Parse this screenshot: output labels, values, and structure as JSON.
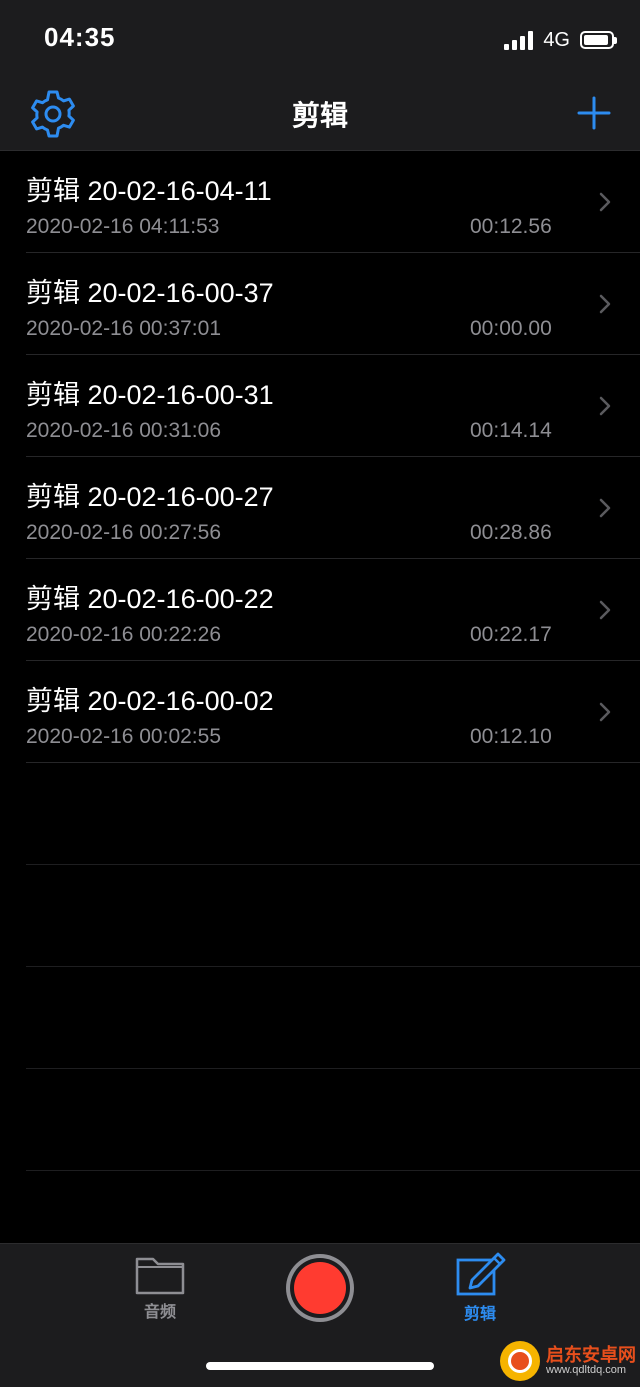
{
  "status_bar": {
    "time": "04:35",
    "network": "4G"
  },
  "nav": {
    "title": "剪辑"
  },
  "recordings": [
    {
      "title": "剪辑 20-02-16-04-11",
      "date": "2020-02-16 04:11:53",
      "duration": "00:12.56"
    },
    {
      "title": "剪辑 20-02-16-00-37",
      "date": "2020-02-16 00:37:01",
      "duration": "00:00.00"
    },
    {
      "title": "剪辑 20-02-16-00-31",
      "date": "2020-02-16 00:31:06",
      "duration": "00:14.14"
    },
    {
      "title": "剪辑 20-02-16-00-27",
      "date": "2020-02-16 00:27:56",
      "duration": "00:28.86"
    },
    {
      "title": "剪辑 20-02-16-00-22",
      "date": "2020-02-16 00:22:26",
      "duration": "00:22.17"
    },
    {
      "title": "剪辑 20-02-16-00-02",
      "date": "2020-02-16 00:02:55",
      "duration": "00:12.10"
    }
  ],
  "tab_bar": {
    "audio_label": "音频",
    "edit_label": "剪辑"
  },
  "watermark": {
    "name": "启东安卓网",
    "url": "www.qdltdq.com"
  },
  "colors": {
    "accent": "#2d8cf0",
    "record": "#ff3b30",
    "secondary_text": "#8e8e93"
  }
}
